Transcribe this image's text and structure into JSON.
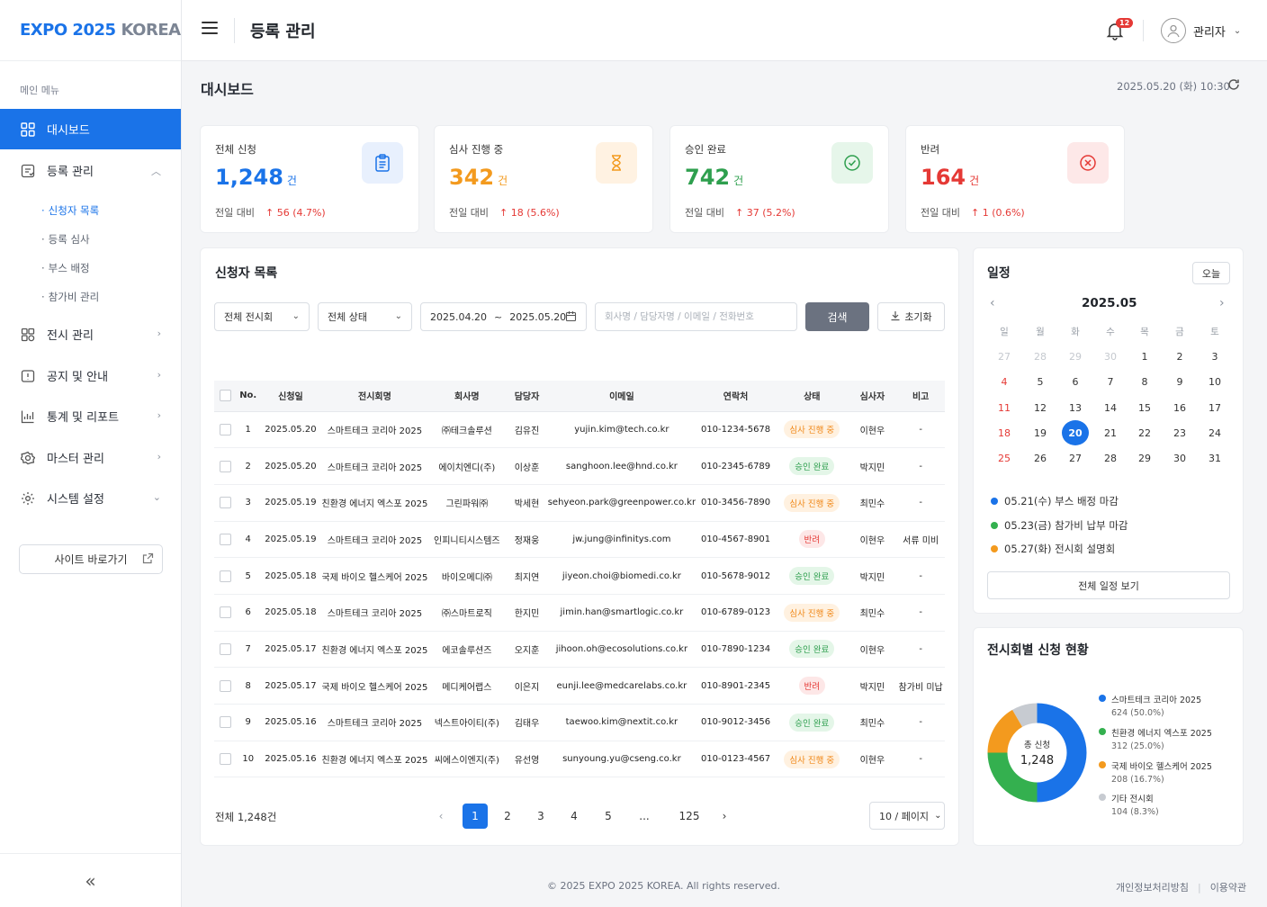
{
  "brand": {
    "part1": "EXPO 2025",
    "part2": "KOREA"
  },
  "sidebar": {
    "caption": "메인 메뉴",
    "items": [
      {
        "label": "대시보드",
        "icon": "grid-icon"
      },
      {
        "label": "등록 관리",
        "icon": "registration-icon"
      },
      {
        "label": "전시 관리",
        "icon": "exhibition-icon"
      },
      {
        "label": "공지 및 안내",
        "icon": "notice-icon"
      },
      {
        "label": "통계 및 리포트",
        "icon": "chart-icon"
      },
      {
        "label": "마스터 관리",
        "icon": "master-icon"
      },
      {
        "label": "시스템 설정",
        "icon": "gear-icon"
      }
    ],
    "subitems": [
      "신청자 목록",
      "등록 심사",
      "부스 배정",
      "참가비 관리"
    ],
    "site_button": "사이트 바로가기",
    "collapse": "«"
  },
  "header": {
    "title": "등록 관리",
    "notif_count": "12",
    "user": "관리자"
  },
  "main": {
    "title": "대시보드",
    "datetime": "2025.05.20 (화) 10:30"
  },
  "stats": [
    {
      "label": "전체 신청",
      "value": "1,248",
      "unit": "건",
      "cmp": "전일 대비",
      "delta": "↑ 56 (4.7%)",
      "color": "#1a73e8"
    },
    {
      "label": "심사 진행 중",
      "value": "342",
      "unit": "건",
      "cmp": "전일 대비",
      "delta": "↑ 18 (5.6%)",
      "color": "#f39a1e"
    },
    {
      "label": "승인 완료",
      "value": "742",
      "unit": "건",
      "cmp": "전일 대비",
      "delta": "↑ 37 (5.2%)",
      "color": "#2e9f4e"
    },
    {
      "label": "반려",
      "value": "164",
      "unit": "건",
      "cmp": "전일 대비",
      "delta": "↑ 1 (0.6%)",
      "color": "#e53935"
    }
  ],
  "applicants": {
    "title": "신청자 목록",
    "filters": {
      "exhibition": "전체 전시회",
      "status": "전체 상태",
      "date_from": "2025.04.20",
      "date_sep": "~",
      "date_to": "2025.05.20",
      "search_placeholder": "회사명 / 담당자명 / 이메일 / 전화번호",
      "search_btn": "검색",
      "reset_btn": "초기화"
    },
    "columns": [
      "No.",
      "신청일",
      "전시회명",
      "회사명",
      "담당자",
      "이메일",
      "연락처",
      "상태",
      "심사자",
      "비고"
    ],
    "rows": [
      [
        "1",
        "2025.05.20",
        "스마트테크 코리아 2025",
        "㈜테크솔루션",
        "김유진",
        "yujin.kim@tech.co.kr",
        "010-1234-5678",
        "심사 진행 중",
        "이현우",
        "-"
      ],
      [
        "2",
        "2025.05.20",
        "스마트테크 코리아 2025",
        "에이치엔디(주)",
        "이상훈",
        "sanghoon.lee@hnd.co.kr",
        "010-2345-6789",
        "승인 완료",
        "박지민",
        "-"
      ],
      [
        "3",
        "2025.05.19",
        "친환경 에너지 엑스포 2025",
        "그린파워㈜",
        "박세현",
        "sehyeon.park@greenpower.co.kr",
        "010-3456-7890",
        "심사 진행 중",
        "최민수",
        "-"
      ],
      [
        "4",
        "2025.05.19",
        "스마트테크 코리아 2025",
        "인피니티시스템즈",
        "정재웅",
        "jw.jung@infinitys.com",
        "010-4567-8901",
        "반려",
        "이현우",
        "서류 미비"
      ],
      [
        "5",
        "2025.05.18",
        "국제 바이오 헬스케어 2025",
        "바이오메디㈜",
        "최지연",
        "jiyeon.choi@biomedi.co.kr",
        "010-5678-9012",
        "승인 완료",
        "박지민",
        "-"
      ],
      [
        "6",
        "2025.05.18",
        "스마트테크 코리아 2025",
        "㈜스마트로직",
        "한지민",
        "jimin.han@smartlogic.co.kr",
        "010-6789-0123",
        "심사 진행 중",
        "최민수",
        "-"
      ],
      [
        "7",
        "2025.05.17",
        "친환경 에너지 엑스포 2025",
        "에코솔루션즈",
        "오지훈",
        "jihoon.oh@ecosolutions.co.kr",
        "010-7890-1234",
        "승인 완료",
        "이현우",
        "-"
      ],
      [
        "8",
        "2025.05.17",
        "국제 바이오 헬스케어 2025",
        "메디케어랩스",
        "이은지",
        "eunji.lee@medcarelabs.co.kr",
        "010-8901-2345",
        "반려",
        "박지민",
        "참가비 미납"
      ],
      [
        "9",
        "2025.05.16",
        "스마트테크 코리아 2025",
        "넥스트아이티(주)",
        "김태우",
        "taewoo.kim@nextit.co.kr",
        "010-9012-3456",
        "승인 완료",
        "최민수",
        "-"
      ],
      [
        "10",
        "2025.05.16",
        "친환경 에너지 엑스포 2025",
        "씨에스이엔지(주)",
        "유선영",
        "sunyoung.yu@cseng.co.kr",
        "010-0123-4567",
        "심사 진행 중",
        "이현우",
        "-"
      ]
    ],
    "total": "전체 1,248건",
    "pages": [
      "1",
      "2",
      "3",
      "4",
      "5",
      "...",
      "125"
    ],
    "per_page": "10 / 페이지"
  },
  "calendar": {
    "title": "일정",
    "today_btn": "오늘",
    "month": "2025.05",
    "weekdays": [
      "일",
      "월",
      "화",
      "수",
      "목",
      "금",
      "토"
    ],
    "weeks": [
      [
        "27",
        "28",
        "29",
        "30",
        "1",
        "2",
        "3"
      ],
      [
        "4",
        "5",
        "6",
        "7",
        "8",
        "9",
        "10"
      ],
      [
        "11",
        "12",
        "13",
        "14",
        "15",
        "16",
        "17"
      ],
      [
        "18",
        "19",
        "20",
        "21",
        "22",
        "23",
        "24"
      ],
      [
        "25",
        "26",
        "27",
        "28",
        "29",
        "30",
        "31"
      ]
    ],
    "today": "20",
    "events": [
      {
        "text": "05.21(수) 부스 배정 마감",
        "color": "#1a73e8"
      },
      {
        "text": "05.23(금) 참가비 납부 마감",
        "color": "#34b04f"
      },
      {
        "text": "05.27(화) 전시회 설명회",
        "color": "#f39a1e"
      }
    ],
    "full_btn": "전체 일정 보기"
  },
  "donut": {
    "title": "전시회별 신청 현황",
    "center_label": "총 신청",
    "center_value": "1,248",
    "chart_data": {
      "type": "pie",
      "categories": [
        "스마트테크 코리아 2025",
        "친환경 에너지 엑스포 2025",
        "국제 바이오 헬스케어 2025",
        "기타 전시회"
      ],
      "values": [
        624,
        312,
        208,
        104
      ],
      "percent_labels": [
        "624 (50.0%)",
        "312 (25.0%)",
        "208 (16.7%)",
        "104 (8.3%)"
      ],
      "colors": [
        "#1a73e8",
        "#34b04f",
        "#f39a1e",
        "#c7cbd1"
      ]
    }
  },
  "footer": {
    "copyright": "© 2025 EXPO 2025 KOREA. All rights reserved.",
    "privacy": "개인정보처리방침",
    "terms": "이용약관"
  }
}
